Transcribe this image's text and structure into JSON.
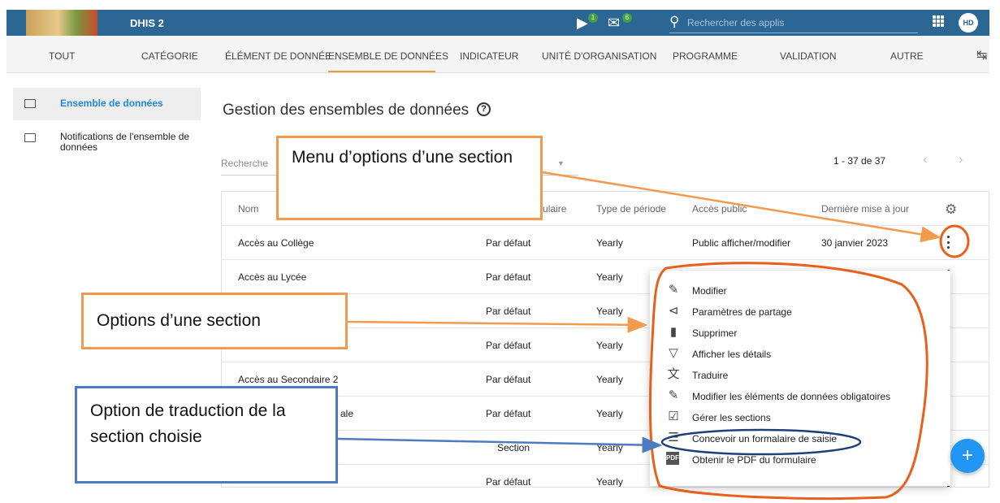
{
  "header": {
    "app_title": "DHIS 2",
    "messages_badge": "1",
    "mail_badge": "6",
    "search_placeholder": "Rechercher des applis",
    "avatar_initials": "HD",
    "accent_color": "#2c6693"
  },
  "tabs": [
    {
      "label": "TOUT"
    },
    {
      "label": "CATÉGORIE"
    },
    {
      "label": "ÉLÉMENT DE DONNÉE"
    },
    {
      "label": "ENSEMBLE DE DONNÉES",
      "active": true
    },
    {
      "label": "INDICATEUR"
    },
    {
      "label": "UNITÉ D'ORGANISATION"
    },
    {
      "label": "PROGRAMME"
    },
    {
      "label": "VALIDATION"
    },
    {
      "label": "AUTRE"
    }
  ],
  "sidebar": {
    "items": [
      {
        "label": "Ensemble de données",
        "active": true,
        "icon": "folder-icon"
      },
      {
        "label": "Notifications de l'ensemble de données",
        "icon": "folder-icon"
      }
    ]
  },
  "main": {
    "title": "Gestion des ensembles de données",
    "search_placeholder": "Recherche",
    "pager": "1 - 37 de 37",
    "columns": [
      "Nom",
      "Type de formulaire",
      "Type de période",
      "Accès public",
      "Dernière mise à jour"
    ],
    "rows": [
      {
        "name": "Accès au Collège",
        "form": "Par défaut",
        "period": "Yearly",
        "access": "Public afficher/modifier",
        "updated": "30 janvier 2023"
      },
      {
        "name": "Accès au Lycée",
        "form": "Par défaut",
        "period": "Yearly",
        "access": "",
        "updated": ""
      },
      {
        "name": "",
        "form": "Par défaut",
        "period": "Yearly",
        "access": "",
        "updated": ""
      },
      {
        "name": "",
        "form": "Par défaut",
        "period": "Yearly",
        "access": "",
        "updated": ""
      },
      {
        "name": "Accès au Secondaire 2",
        "form": "Par défaut",
        "period": "Yearly",
        "access": "",
        "updated": ""
      },
      {
        "name": "ale",
        "form": "Par défaut",
        "period": "Yearly",
        "access": "",
        "updated": ""
      },
      {
        "name": "",
        "form": "Section",
        "period": "Yearly",
        "access": "",
        "updated": ""
      },
      {
        "name": "",
        "form": "Par défaut",
        "period": "Yearly",
        "access": "",
        "updated": ""
      }
    ]
  },
  "context_menu": {
    "items": [
      {
        "label": "Modifier",
        "icon": "pencil-icon"
      },
      {
        "label": "Paramètres de partage",
        "icon": "share-icon"
      },
      {
        "label": "Supprimer",
        "icon": "trash-icon"
      },
      {
        "label": "Afficher les détails",
        "icon": "triangle-down-icon"
      },
      {
        "label": "Traduire",
        "icon": "translate-icon"
      },
      {
        "label": "Modifier les éléments de données obligatoires",
        "icon": "pencil-icon"
      },
      {
        "label": "Gérer les sections",
        "icon": "clipboard-check-icon"
      },
      {
        "label": "Concevoir un formalaire de saisie",
        "icon": "clipboard-list-icon"
      },
      {
        "label": "Obtenir le PDF du formulaire",
        "icon": "pdf-icon"
      }
    ]
  },
  "annotations": {
    "menu_options": "Menu d’options d’une section",
    "section_options": "Options d’une section",
    "translation_option": "Option de traduction de la section choisie",
    "orange": "#f29a4e",
    "blue": "#4d7bbf"
  }
}
